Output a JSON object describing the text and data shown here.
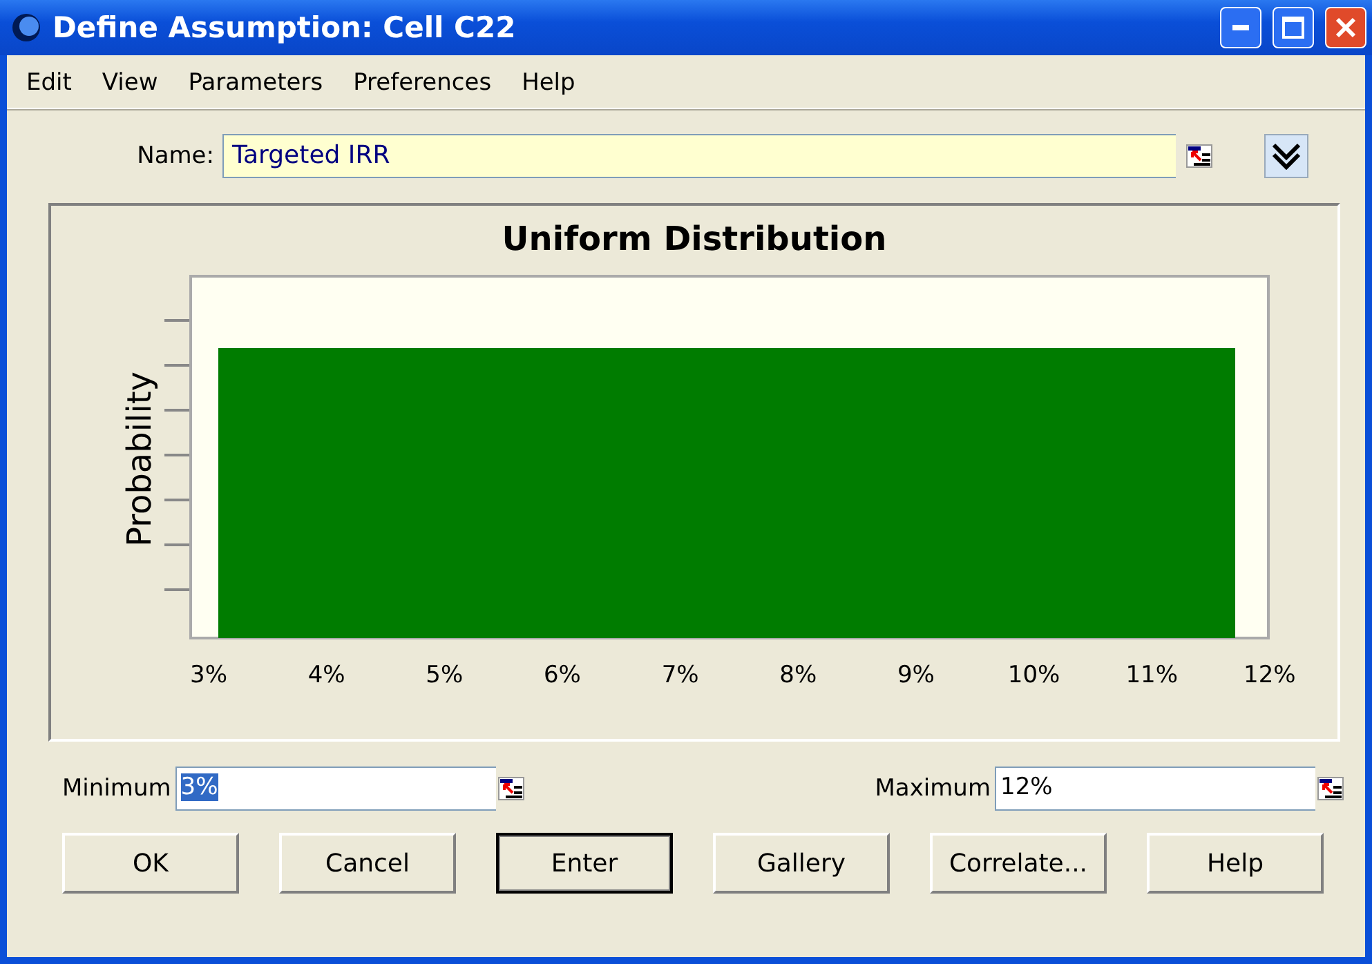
{
  "window": {
    "title": "Define Assumption: Cell C22"
  },
  "menu": [
    "Edit",
    "View",
    "Parameters",
    "Preferences",
    "Help"
  ],
  "name_field": {
    "label": "Name:",
    "value": "Targeted IRR"
  },
  "chart": {
    "title": "Uniform Distribution",
    "ylabel": "Probability",
    "xticks": [
      "3%",
      "4%",
      "5%",
      "6%",
      "7%",
      "8%",
      "9%",
      "10%",
      "11%",
      "12%"
    ]
  },
  "fields": [
    {
      "label": "Minimum",
      "value": "3%",
      "text_selected": true
    },
    {
      "label": "Maximum",
      "value": "12%",
      "text_selected": false
    }
  ],
  "buttons": [
    {
      "label": "OK",
      "default": false
    },
    {
      "label": "Cancel",
      "default": false
    },
    {
      "label": "Enter",
      "default": true
    },
    {
      "label": "Gallery",
      "default": false
    },
    {
      "label": "Correlate...",
      "default": false
    },
    {
      "label": "Help",
      "default": false
    }
  ]
}
